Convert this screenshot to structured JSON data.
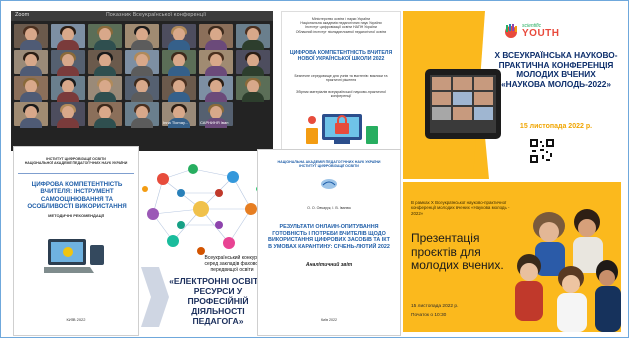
{
  "video": {
    "window_title": "Zoom",
    "center_title": "Показник Всеукраїнської конференції",
    "participants": [
      {
        "name": ""
      },
      {
        "name": ""
      },
      {
        "name": ""
      },
      {
        "name": ""
      },
      {
        "name": ""
      },
      {
        "name": ""
      },
      {
        "name": ""
      },
      {
        "name": ""
      },
      {
        "name": ""
      },
      {
        "name": ""
      },
      {
        "name": ""
      },
      {
        "name": ""
      },
      {
        "name": ""
      },
      {
        "name": ""
      },
      {
        "name": ""
      },
      {
        "name": ""
      },
      {
        "name": ""
      },
      {
        "name": ""
      },
      {
        "name": ""
      },
      {
        "name": ""
      },
      {
        "name": ""
      },
      {
        "name": ""
      },
      {
        "name": ""
      },
      {
        "name": ""
      },
      {
        "name": ""
      },
      {
        "name": "Inna Tlomay..."
      },
      {
        "name": "САРНИНЯ Іван"
      }
    ]
  },
  "doc1": {
    "header": "Міністерство освіти і науки України\nНаціональна академія педагогічних наук України\nІнститут цифровізації освіти НАПН України\nОбласний інститут післядипломної педагогічної освіти",
    "title": "ЦИФРОВА КОМПЕТЕНТНІСТЬ ВЧИТЕЛЯ НОВОЇ УКРАЇНСЬКОЇ ШКОЛИ 2022",
    "subtitle": "Безпечне середовище для учнів та вчителів: виклики та практичні рішення",
    "footer": "Збірник матеріалів всеукраїнської науково-практичної конференції"
  },
  "conf": {
    "logo_small": "scientific",
    "logo_big": "YOUTH",
    "title": "Х ВСЕУКРАЇНСЬКА НАУКОВО-ПРАКТИЧНА КОНФЕРЕНЦІЯ МОЛОДИХ ВЧЕНИХ «НАУКОВА МОЛОДЬ-2022»",
    "date": "15 листопада 2022 р."
  },
  "pres": {
    "intro": "В рамках Х Всеукраїнської науково-практичної конференції молодих вчених «Наукова молодь - 2022»",
    "title": "Презентація проєктів для молодих вчених.",
    "date": "15 листопада 2022 р.",
    "time": "Початок о 10:30"
  },
  "book": {
    "org": "ІНСТИТУТ ЦИФРОВІЗАЦІЇ ОСВІТИ\nНАЦІОНАЛЬНОЇ АКАДЕМІЇ ПЕДАГОГІЧНИХ НАУК УКРАЇНИ",
    "title": "ЦИФРОВА КОМПЕТЕНТНІСТЬ ВЧИТЕЛЯ: ІНСТРУМЕНТ САМООЦІНЮВАННЯ ТА ОСОБЛИВОСТІ ВИКОРИСТАННЯ",
    "kind": "МЕТОДИЧНІ РЕКОМЕНДАЦІЇ",
    "city": "КИЇВ 2022"
  },
  "net": {
    "line1": "Всеукраїнський конкурс",
    "line2": "серед закладів фахової",
    "line3": "передвищої освіти",
    "title": "«ЕЛЕКТРОННІ ОСВІТНІ РЕСУРСИ У ПРОФЕСІЙНІЙ ДІЯЛЬНОСТІ ПЕДАГОГА»"
  },
  "paper": {
    "org": "НАЦІОНАЛЬНА АКАДЕМІЯ ПЕДАГОГІЧНИХ НАУК УКРАЇНИ\nІНСТИТУТ ЦИФРОВІЗАЦІЇ ОСВІТИ",
    "authors": "О. О. Овчарук, І. В. Іванюк",
    "title": "РЕЗУЛЬТАТИ ОНЛАЙН-ОПИТУВАННЯ ГОТОВНІСТЬ І ПОТРЕБИ ВЧИТЕЛІВ ЩОДО ВИКОРИСТАННЯ ЦИФРОВИХ ЗАСОБІВ ТА ІКТ В УМОВАХ КАРАНТИНУ: СІЧЕНЬ-ЛЮТИЙ 2022",
    "kind": "Аналітичний звіт",
    "city": "Київ 2022"
  }
}
